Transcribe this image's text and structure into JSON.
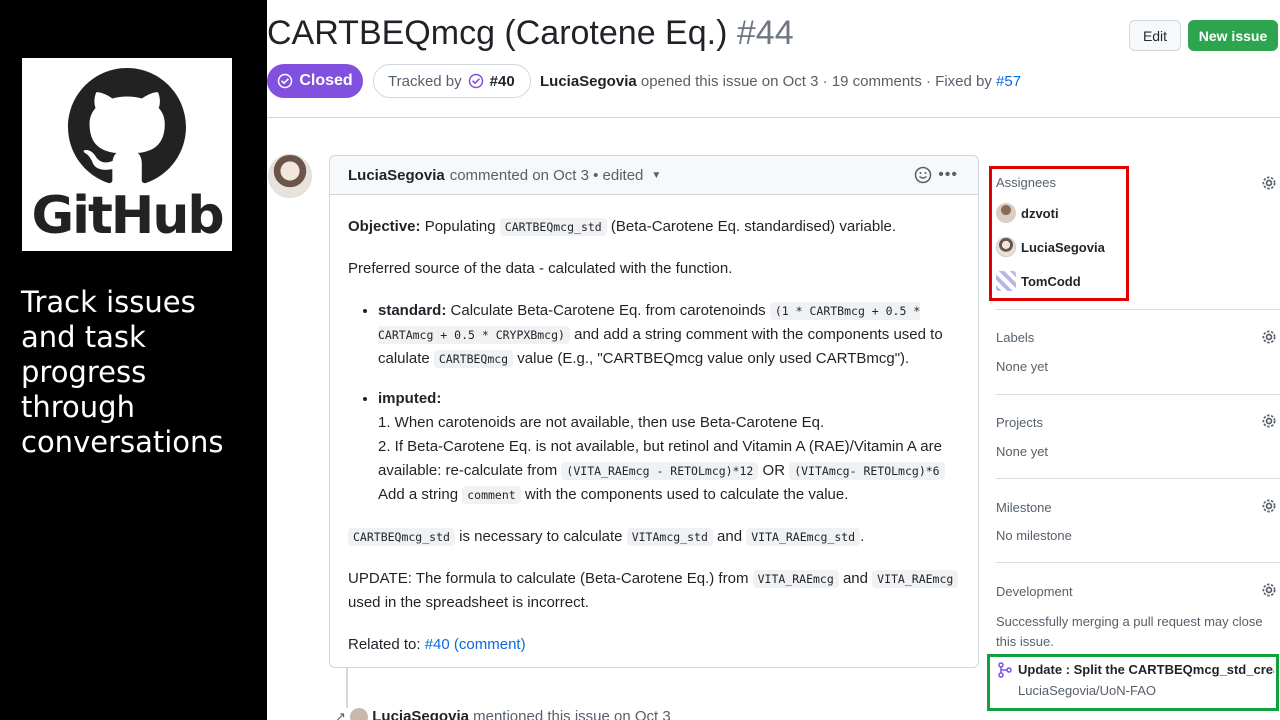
{
  "slide": {
    "logo_text": "GitHub",
    "tagline": "Track issues and task progress through conversations"
  },
  "issue": {
    "title": "CARTBEQmcg (Carotene Eq.)",
    "number": "#44",
    "status": "Closed",
    "tracked_label": "Tracked by",
    "tracked_ref": "#40",
    "author": "LuciaSegovia",
    "opened_text": "opened this issue on Oct 3 · 19 comments · Fixed by",
    "fixed_ref": "#57"
  },
  "header_buttons": {
    "edit": "Edit",
    "new_issue": "New issue"
  },
  "comment": {
    "author": "LuciaSegovia",
    "meta": "commented on Oct 3 • edited",
    "objective_label": "Objective:",
    "objective_pre": "Populating",
    "objective_code": "CARTBEQmcg_std",
    "objective_post": "(Beta-Carotene Eq. standardised) variable.",
    "preferred": "Preferred source of the data - calculated with the function.",
    "standard_label": "standard:",
    "standard_pre": "Calculate Beta-Carotene Eq. from carotenoinds",
    "standard_code": "(1 * CARTBmcg + 0.5 * CARTAmcg + 0.5 * CRYPXBmcg)",
    "standard_mid": "and add a string comment with the components used to calulate",
    "standard_code2": "CARTBEQmcg",
    "standard_post": "value (E.g., \"CARTBEQmcg value only used CARTBmcg\").",
    "imputed_label": "imputed:",
    "imputed_1": "1. When carotenoids are not available, then use Beta-Carotene Eq.",
    "imputed_2_pre": "2. If Beta-Carotene Eq. is not available, but retinol and Vitamin A (RAE)/Vitamin A are available: re-calculate from",
    "imputed_2_code1": "(VITA_RAEmcg - RETOLmcg)*12",
    "imputed_2_or": "OR",
    "imputed_2_code2": "(VITAmcg- RETOLmcg)*6",
    "imputed_3_pre": "Add a string",
    "imputed_3_code": "comment",
    "imputed_3_post": "with the components used to calculate the value.",
    "nec_code1": "CARTBEQmcg_std",
    "nec_mid": "is necessary to calculate",
    "nec_code2": "VITAmcg_std",
    "nec_and": "and",
    "nec_code3": "VITA_RAEmcg_std",
    "nec_end": ".",
    "update_pre": "UPDATE: The formula to calculate (Beta-Carotene Eq.) from",
    "update_code1": "VITA_RAEmcg",
    "update_and": "and",
    "update_code2": "VITA_RAEmcg",
    "update_post": "used in the spreadsheet is incorrect.",
    "related_pre": "Related to:",
    "related_link": "#40 (comment)"
  },
  "mention": {
    "author": "LuciaSegovia",
    "text": "mentioned this issue on Oct 3"
  },
  "sidebar": {
    "assignees_title": "Assignees",
    "assignees": [
      "dzvoti",
      "LuciaSegovia",
      "TomCodd"
    ],
    "labels_title": "Labels",
    "labels_value": "None yet",
    "projects_title": "Projects",
    "projects_value": "None yet",
    "milestone_title": "Milestone",
    "milestone_value": "No milestone",
    "development_title": "Development",
    "development_text": "Successfully merging a pull request may close this issue.",
    "pr_title": "Update : Split the CARTBEQmcg_std_creator",
    "pr_repo": "LuciaSegovia/UoN-FAO"
  },
  "colors": {
    "closed": "#8250df",
    "new_issue": "#2da44e",
    "link": "#0969da",
    "highlight_red": "#e00000",
    "highlight_green": "#10a03c"
  }
}
